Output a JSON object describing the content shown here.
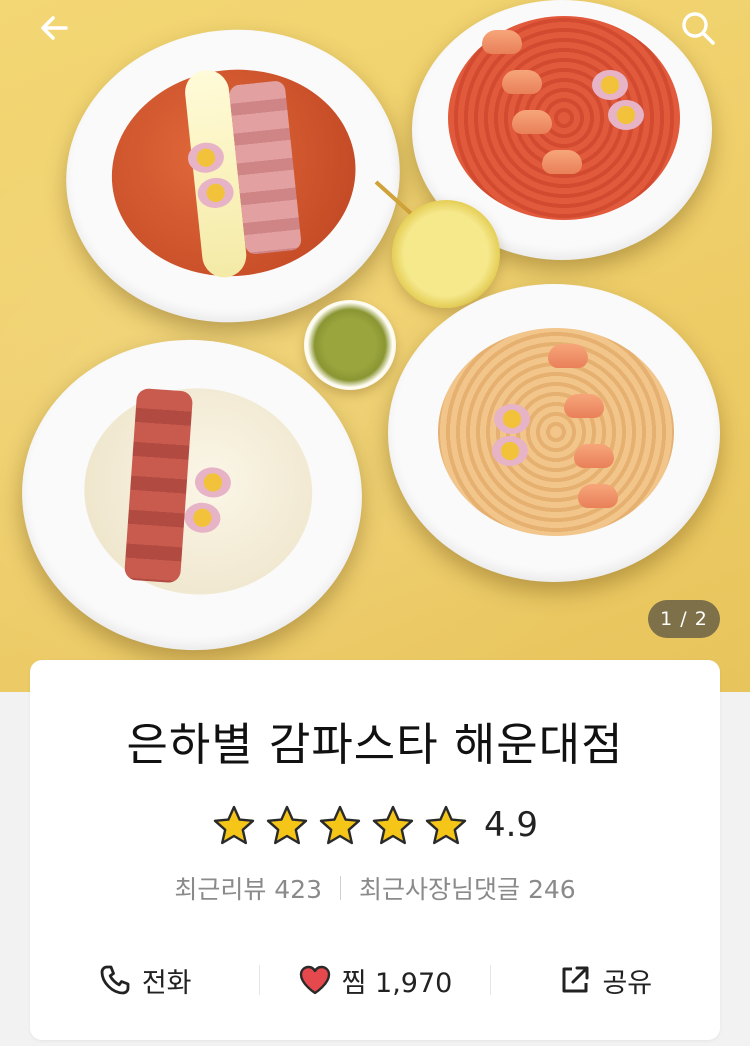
{
  "header": {
    "back_icon": "arrow-left-icon",
    "search_icon": "search-icon"
  },
  "gallery": {
    "indicator": "1 / 2",
    "current": 1,
    "total": 2
  },
  "store": {
    "name": "은하별 감파스타 해운대점",
    "rating": "4.9",
    "rating_value": 4.9,
    "stars_filled": 5,
    "star_color": "#f5c518",
    "reviews_label": "최근리뷰 423",
    "owner_replies_label": "최근사장님댓글 246"
  },
  "actions": {
    "call": {
      "label": "전화",
      "icon": "phone-icon"
    },
    "wish": {
      "label": "찜 1,970",
      "icon": "heart-icon",
      "color": "#e5484d"
    },
    "share": {
      "label": "공유",
      "icon": "share-icon"
    }
  }
}
